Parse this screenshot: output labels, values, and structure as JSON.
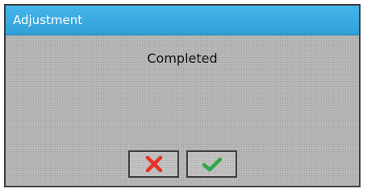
{
  "dialog": {
    "title": "Adjustment",
    "message": "Completed",
    "buttons": {
      "cancel": {
        "icon": "close-icon",
        "color": "#e8302c"
      },
      "confirm": {
        "icon": "check-icon",
        "color": "#2ea84a"
      }
    }
  },
  "colors": {
    "title_bar": "#35a8e0",
    "panel_background": "#b9b9b9",
    "border": "#3f3f3f"
  }
}
